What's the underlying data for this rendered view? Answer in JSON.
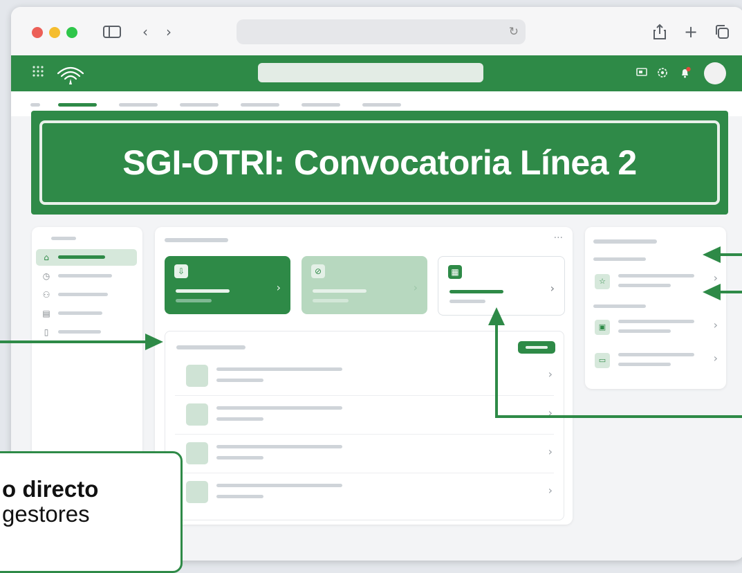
{
  "banner": {
    "title": "SGI-OTRI: Convocatoria Línea 2"
  },
  "callout": {
    "line1": "o directo",
    "line2": "gestores"
  },
  "icons": {
    "browser": [
      "sidebar-toggle-icon",
      "back-icon",
      "forward-icon",
      "reload-icon",
      "share-icon",
      "new-tab-icon",
      "tabs-overview-icon"
    ],
    "appbar": [
      "apps-grid-icon",
      "logo-icon",
      "cast-icon",
      "settings-icon",
      "notification-bell-icon",
      "user-avatar"
    ]
  },
  "colors": {
    "brand_green": "#2e8a47",
    "light_green": "#b7d8bf",
    "traffic_red": "#ec5f57",
    "traffic_yellow": "#f5bd2f",
    "traffic_green": "#2ec64a"
  }
}
